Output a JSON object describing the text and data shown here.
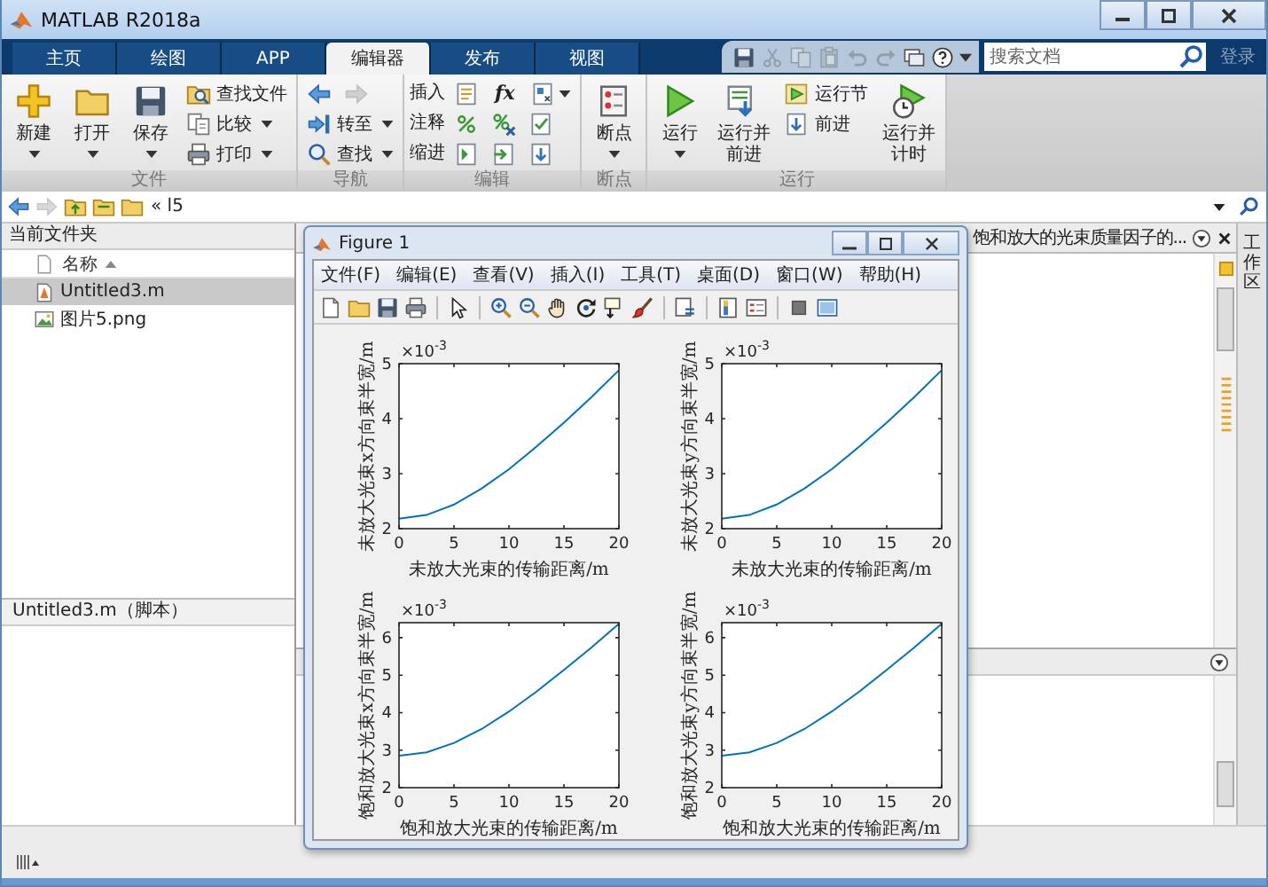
{
  "window": {
    "title": "MATLAB R2018a"
  },
  "tabs": [
    {
      "label": "主页",
      "selected": false
    },
    {
      "label": "绘图",
      "selected": false
    },
    {
      "label": "APP",
      "selected": false
    },
    {
      "label": "编辑器",
      "selected": true
    },
    {
      "label": "发布",
      "selected": false
    },
    {
      "label": "视图",
      "selected": false
    }
  ],
  "quick_access": [
    {
      "disabled": false
    },
    {
      "disabled": true
    },
    {
      "disabled": true
    },
    {
      "disabled": true
    },
    {
      "disabled": true
    },
    {
      "disabled": true
    },
    {
      "disabled": false
    },
    {
      "disabled": false
    }
  ],
  "search": {
    "placeholder": "搜索文档"
  },
  "sign_in": "登录",
  "ribbon": [
    {
      "label": "文件",
      "columns": [
        [
          [
            {
              "kind": "large",
              "label": "新建",
              "dropdown": true
            }
          ]
        ],
        [
          [
            {
              "kind": "large",
              "label": "打开",
              "dropdown": true
            }
          ]
        ],
        [
          [
            {
              "kind": "large",
              "label": "保存",
              "dropdown": true
            }
          ]
        ],
        [
          [
            {
              "kind": "small",
              "label": "查找文件",
              "dropdown": false
            }
          ],
          [
            {
              "kind": "small",
              "label": "比较",
              "dropdown": true
            }
          ],
          [
            {
              "kind": "small",
              "label": "打印",
              "dropdown": true
            }
          ]
        ]
      ]
    },
    {
      "label": "导航",
      "columns": [
        [
          [
            {
              "kind": "icon",
              "dropdown": false,
              "disabled": false
            },
            {
              "kind": "icon",
              "dropdown": false,
              "disabled": true
            }
          ],
          [
            {
              "kind": "small",
              "label": "转至",
              "dropdown": true
            }
          ],
          [
            {
              "kind": "small",
              "label": "查找",
              "dropdown": true
            }
          ]
        ]
      ]
    },
    {
      "label": "编辑",
      "columns": [
        [
          [
            {
              "kind": "label",
              "label": "插入"
            },
            {
              "kind": "icon",
              "dropdown": false
            },
            {
              "kind": "glyph",
              "label": "fx"
            },
            {
              "kind": "icon",
              "dropdown": true
            }
          ],
          [
            {
              "kind": "label",
              "label": "注释"
            },
            {
              "kind": "icon",
              "dropdown": false
            },
            {
              "kind": "icon",
              "dropdown": false
            },
            {
              "kind": "icon",
              "dropdown": false
            }
          ],
          [
            {
              "kind": "label",
              "label": "缩进"
            },
            {
              "kind": "icon",
              "dropdown": false
            },
            {
              "kind": "icon",
              "dropdown": false
            },
            {
              "kind": "icon",
              "dropdown": false
            }
          ]
        ]
      ]
    },
    {
      "label": "断点",
      "columns": [
        [
          [
            {
              "kind": "large",
              "label": "断点",
              "dropdown": true
            }
          ]
        ]
      ]
    },
    {
      "label": "运行",
      "columns": [
        [
          [
            {
              "kind": "large",
              "label": "运行",
              "dropdown": true
            }
          ]
        ],
        [
          [
            {
              "kind": "large",
              "label": "运行并前进",
              "dropdown": false
            }
          ]
        ],
        [
          [
            {
              "kind": "small",
              "label": "运行节",
              "dropdown": false
            }
          ],
          [
            {
              "kind": "small",
              "label": "前进",
              "dropdown": false
            }
          ]
        ],
        [
          [
            {
              "kind": "large",
              "label": "运行并计时",
              "dropdown": false
            }
          ]
        ]
      ]
    }
  ],
  "address": {
    "path": "« l5"
  },
  "file_browser": {
    "title": "当前文件夹",
    "column": "名称",
    "sort_ascending": true,
    "files": [
      {
        "name": "Untitled3.m",
        "kind": "script",
        "selected": true
      },
      {
        "name": "图片5.png",
        "kind": "image",
        "selected": false
      }
    ],
    "details": "Untitled3.m（脚本）"
  },
  "editor": {
    "tab_title": "饱和放大的光束质量因子的..."
  },
  "workspace_tab": "工作区",
  "figure": {
    "title": "Figure 1",
    "menu": [
      "文件(F)",
      "编辑(E)",
      "查看(V)",
      "插入(I)",
      "工具(T)",
      "桌面(D)",
      "窗口(W)",
      "帮助(H)"
    ],
    "plots": [
      {
        "scale_base": "×10",
        "scale_exponent": "-3",
        "chart_data": {
          "type": "line",
          "xlabel": "未放大光束的传输距离/m",
          "ylabel": "未放大光束x方向束半宽/m",
          "x": [
            0,
            2.5,
            5,
            7.5,
            10,
            12.5,
            15,
            17.5,
            20
          ],
          "series": [
            {
              "color": "#0072bd",
              "values": [
                2.18,
                2.25,
                2.44,
                2.73,
                3.08,
                3.49,
                3.93,
                4.39,
                4.88
              ]
            }
          ],
          "xlim": [
            0,
            20
          ],
          "ylim": [
            2,
            5
          ],
          "xticks": [
            0,
            5,
            10,
            15,
            20
          ],
          "yticks": [
            2,
            3,
            4,
            5
          ]
        }
      },
      {
        "scale_base": "×10",
        "scale_exponent": "-3",
        "chart_data": {
          "type": "line",
          "xlabel": "未放大光束的传输距离/m",
          "ylabel": "未放大光束y方向束半宽/m",
          "x": [
            0,
            2.5,
            5,
            7.5,
            10,
            12.5,
            15,
            17.5,
            20
          ],
          "series": [
            {
              "color": "#0072bd",
              "values": [
                2.18,
                2.25,
                2.44,
                2.73,
                3.08,
                3.49,
                3.93,
                4.39,
                4.88
              ]
            }
          ],
          "xlim": [
            0,
            20
          ],
          "ylim": [
            2,
            5
          ],
          "xticks": [
            0,
            5,
            10,
            15,
            20
          ],
          "yticks": [
            2,
            3,
            4,
            5
          ]
        }
      },
      {
        "scale_base": "×10",
        "scale_exponent": "-3",
        "chart_data": {
          "type": "line",
          "xlabel": "饱和放大光束的传输距离/m",
          "ylabel": "饱和放大光束x方向束半宽/m",
          "x": [
            0,
            2.5,
            5,
            7.5,
            10,
            12.5,
            15,
            17.5,
            20
          ],
          "series": [
            {
              "color": "#0072bd",
              "values": [
                2.85,
                2.94,
                3.19,
                3.56,
                4.03,
                4.56,
                5.14,
                5.74,
                6.37
              ]
            }
          ],
          "xlim": [
            0,
            20
          ],
          "ylim": [
            2,
            6.4
          ],
          "xticks": [
            0,
            5,
            10,
            15,
            20
          ],
          "yticks": [
            2,
            3,
            4,
            5,
            6
          ]
        }
      },
      {
        "scale_base": "×10",
        "scale_exponent": "-3",
        "chart_data": {
          "type": "line",
          "xlabel": "饱和放大光束的传输距离/m",
          "ylabel": "饱和放大光束y方向束半宽/m",
          "x": [
            0,
            2.5,
            5,
            7.5,
            10,
            12.5,
            15,
            17.5,
            20
          ],
          "series": [
            {
              "color": "#0072bd",
              "values": [
                2.85,
                2.94,
                3.19,
                3.56,
                4.03,
                4.56,
                5.14,
                5.74,
                6.37
              ]
            }
          ],
          "xlim": [
            0,
            20
          ],
          "ylim": [
            2,
            6.4
          ],
          "xticks": [
            0,
            5,
            10,
            15,
            20
          ],
          "yticks": [
            2,
            3,
            4,
            5,
            6
          ]
        }
      }
    ]
  }
}
